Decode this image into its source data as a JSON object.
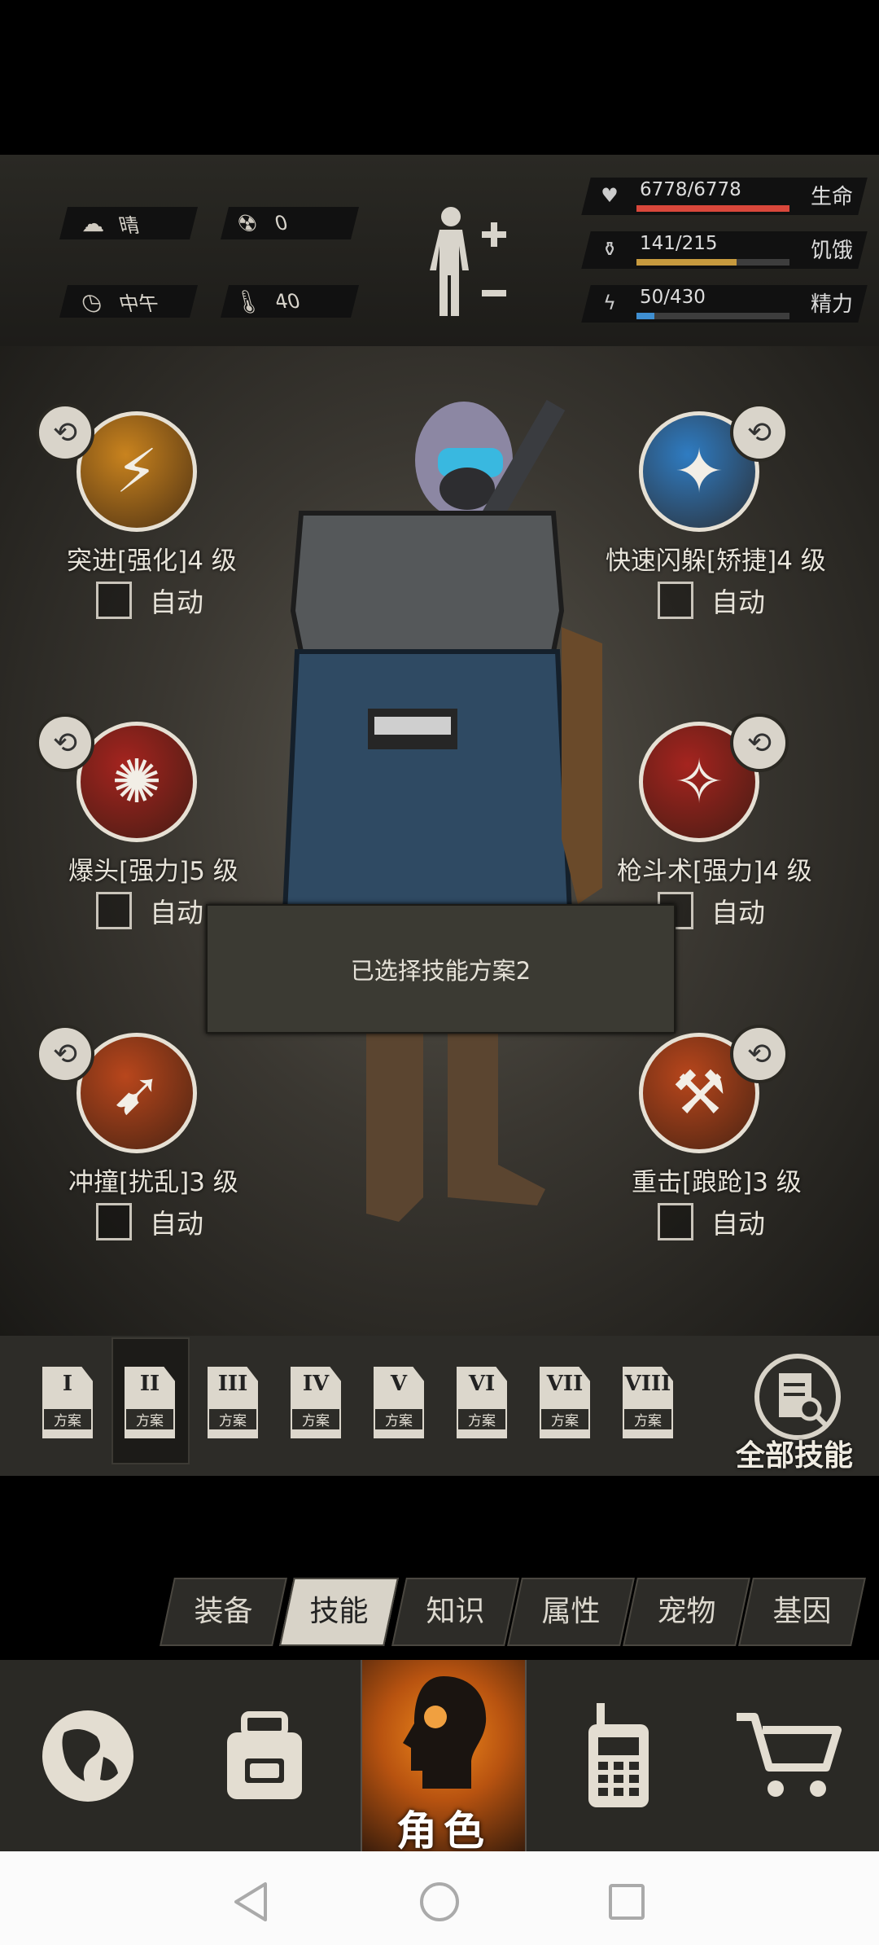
{
  "status": {
    "weather": {
      "icon": "cloudy-sun-icon",
      "label": "晴"
    },
    "radiation": {
      "icon": "radiation-icon",
      "value": "0"
    },
    "time": {
      "icon": "clock-icon",
      "label": "中午"
    },
    "temperature": {
      "icon": "thermometer-icon",
      "value": "40"
    },
    "health": {
      "value": "6778/6778",
      "label": "生命",
      "fill": 1.0,
      "color": "#d9473b"
    },
    "hunger": {
      "value": "141/215",
      "label": "饥饿",
      "fill": 0.656,
      "color": "#c79a3e"
    },
    "energy": {
      "value": "50/430",
      "label": "精力",
      "fill": 0.116,
      "color": "#3f8fd1"
    }
  },
  "skills": [
    {
      "name": "突进[强化]4 级",
      "auto_label": "自动",
      "icon": "dash-icon",
      "color": "#c9831e"
    },
    {
      "name": "快速闪躲[矫捷]4 级",
      "auto_label": "自动",
      "icon": "dodge-icon",
      "color": "#2f7cc2"
    },
    {
      "name": "爆头[强力]5 级",
      "auto_label": "自动",
      "icon": "headshot-icon",
      "color": "#a5241f"
    },
    {
      "name": "枪斗术[强力]4 级",
      "auto_label": "自动",
      "icon": "gun-kata-icon",
      "color": "#a5241f"
    },
    {
      "name": "冲撞[扰乱]3 级",
      "auto_label": "自动",
      "icon": "charge-icon",
      "color": "#b8461c"
    },
    {
      "name": "重击[踉跄]3 级",
      "auto_label": "自动",
      "icon": "heavy-strike-icon",
      "color": "#b8461c"
    }
  ],
  "toast": "已选择技能方案2",
  "presets": {
    "numerals": [
      "I",
      "II",
      "III",
      "IV",
      "V",
      "VI",
      "VII",
      "VIII"
    ],
    "label": "方案",
    "selected_index": 1,
    "all_skills_label": "全部技能"
  },
  "tabs": [
    "装备",
    "技能",
    "知识",
    "属性",
    "宠物",
    "基因"
  ],
  "active_tab": "技能",
  "nav": {
    "role_label": "角色"
  }
}
